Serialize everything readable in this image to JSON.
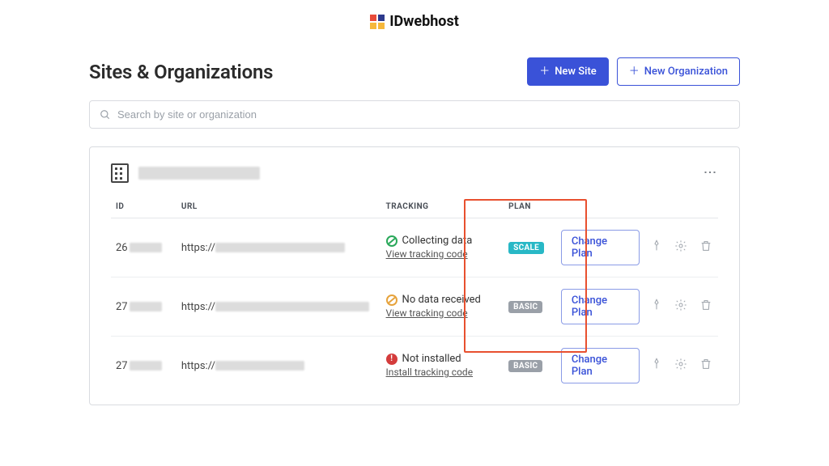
{
  "brand": {
    "name": "IDwebhost"
  },
  "page": {
    "title": "Sites & Organizations"
  },
  "actions": {
    "new_site": "New Site",
    "new_org": "New Organization"
  },
  "search": {
    "placeholder": "Search by site or organization"
  },
  "columns": {
    "id": "ID",
    "url": "URL",
    "tracking": "TRACKING",
    "plan": "PLAN"
  },
  "rows": [
    {
      "id_prefix": "26",
      "url_prefix": "https://",
      "tracking_status": "Collecting data",
      "tracking_link": "View tracking code",
      "plan_badge": "SCALE",
      "change_plan": "Change Plan"
    },
    {
      "id_prefix": "27",
      "url_prefix": "https://",
      "tracking_status": "No data received",
      "tracking_link": "View tracking code",
      "plan_badge": "BASIC",
      "change_plan": "Change Plan"
    },
    {
      "id_prefix": "27",
      "url_prefix": "https://",
      "tracking_status": "Not installed",
      "tracking_link": "Install tracking code",
      "plan_badge": "BASIC",
      "change_plan": "Change Plan"
    }
  ]
}
